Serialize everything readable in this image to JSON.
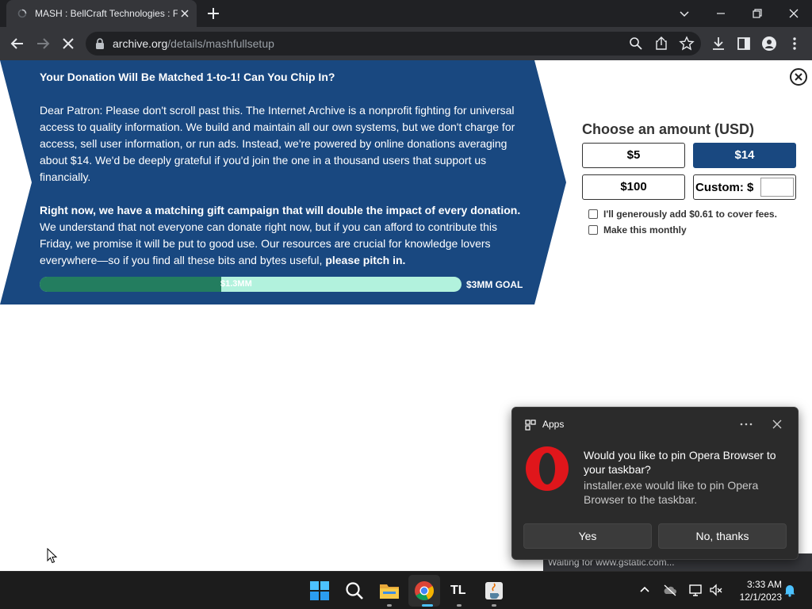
{
  "browser": {
    "tab_title": "MASH : BellCraft Technologies : F",
    "url_host": "archive.org",
    "url_path": "/details/mashfullsetup",
    "status_text": "Waiting for www.gstatic.com..."
  },
  "banner": {
    "heading": "Your Donation Will Be Matched 1-to-1! Can You Chip In?",
    "para1": "Dear Patron: Please don't scroll past this. The Internet Archive is a nonprofit fighting for universal access to quality information. We build and maintain all our own systems, but we don't charge for access, sell user information, or run ads. Instead, we're powered by online donations averaging about $14. We'd be deeply grateful if you'd join the one in a thousand users that support us financially.",
    "para2_bold": "Right now, we have a matching gift campaign that will double the impact of every donation.",
    "para2_text": " We understand that not everyone can donate right now, but if you can afford to contribute this Friday, we promise it will be put to good use. Our resources are crucial for knowledge lovers everywhere—so if you find all these bits and bytes useful, ",
    "para2_end_bold": "please pitch in.",
    "progress_label": "$1.3MM",
    "progress_fraction": 0.43,
    "goal_label": "$3MM GOAL",
    "colors": {
      "banner": "#194880",
      "progress_fill": "#237d5f",
      "progress_track": "#b2f2dd"
    }
  },
  "donate": {
    "title": "Choose an amount (USD)",
    "amounts": [
      "$5",
      "$14",
      "$100"
    ],
    "selected": "$14",
    "custom_label": "Custom: $",
    "custom_value": "",
    "fee_label": "I'll generously add $0.61 to cover fees.",
    "monthly_label": "Make this monthly"
  },
  "toast": {
    "app_name": "Apps",
    "title": "Would you like to pin Opera Browser to your taskbar?",
    "body": "installer.exe would like to pin Opera Browser to the taskbar.",
    "yes_label": "Yes",
    "no_label": "No, thanks"
  },
  "taskbar": {
    "apps": [
      "start-icon",
      "search-icon",
      "file-explorer-icon",
      "chrome-icon",
      "tl-app-icon",
      "java-icon"
    ],
    "tl_label": "TL",
    "time": "3:33 AM",
    "date": "12/1/2023"
  }
}
